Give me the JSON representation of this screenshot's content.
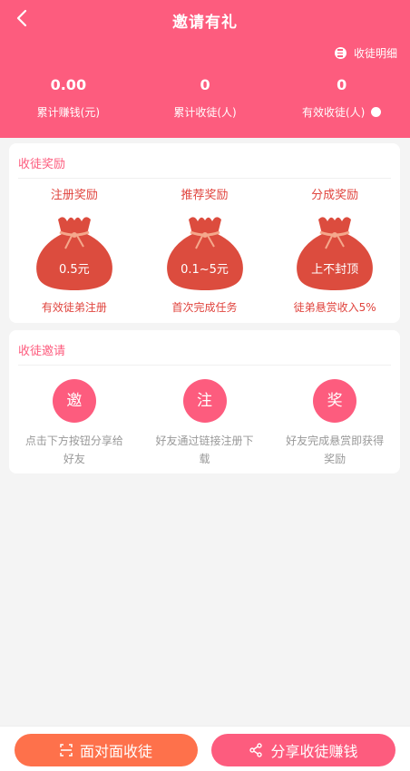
{
  "header": {
    "title": "邀请有礼",
    "detail_link": "收徒明细",
    "stats": [
      {
        "value": "0.00",
        "label": "累计赚钱(元)"
      },
      {
        "value": "0",
        "label": "累计收徒(人)"
      },
      {
        "value": "0",
        "label": "有效收徒(人)"
      }
    ]
  },
  "rewards_card": {
    "title": "收徒奖励",
    "items": [
      {
        "title": "注册奖励",
        "value": "0.5元",
        "desc": "有效徒弟注册"
      },
      {
        "title": "推荐奖励",
        "value": "0.1~5元",
        "desc": "首次完成任务"
      },
      {
        "title": "分成奖励",
        "value": "上不封顶",
        "desc": "徒弟悬赏收入5%"
      }
    ]
  },
  "invite_card": {
    "title": "收徒邀请",
    "steps": [
      {
        "char": "邀",
        "text": "点击下方按钮分享给好友"
      },
      {
        "char": "注",
        "text": "好友通过链接注册下载"
      },
      {
        "char": "奖",
        "text": "好友完成悬赏即获得奖励"
      }
    ]
  },
  "bottom": {
    "face_button": "面对面收徒",
    "share_button": "分享收徒赚钱"
  },
  "colors": {
    "primary": "#fd5c7e",
    "orange": "#fe714b",
    "bag": "#dc4c3e",
    "reward_text": "#e0443e"
  }
}
